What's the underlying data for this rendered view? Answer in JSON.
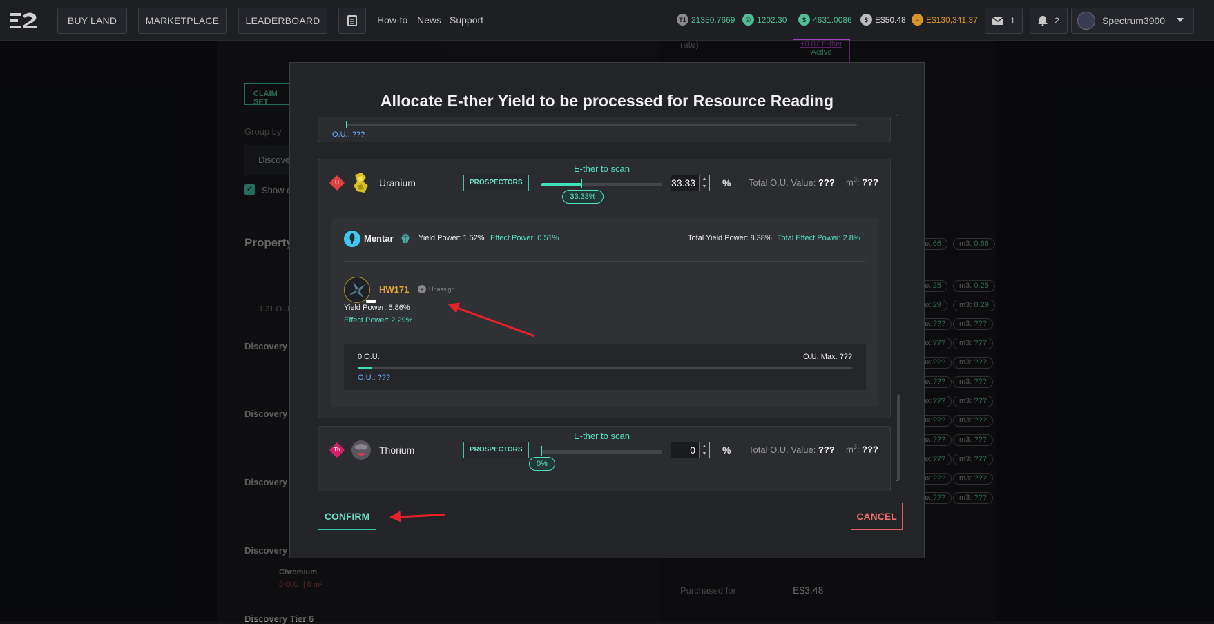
{
  "nav": {
    "buy_land": "BUY LAND",
    "marketplace": "MARKETPLACE",
    "leaderboard": "LEADERBOARD",
    "howto": "How-to",
    "news": "News",
    "support": "Support",
    "stats": [
      {
        "value": "21350.7669",
        "color": "#4fbf93",
        "icon": "t1"
      },
      {
        "value": "1202.30",
        "color": "#4fbf93",
        "icon": "g"
      },
      {
        "value": "4631.0086",
        "color": "#4fbf93",
        "icon": "s"
      },
      {
        "value": "E$50.48",
        "color": "#d8d8d8",
        "icon": "$"
      },
      {
        "value": "E$130,341.37",
        "color": "#d9952a",
        "icon": "b"
      }
    ],
    "messages_count": "1",
    "notifications_count": "2",
    "username": "Spectrum3900"
  },
  "background": {
    "claim": "CLAIM SET",
    "group_by": "Group by",
    "discover": "Discove",
    "show": "Show e",
    "property": "Property",
    "ou_value": "1.31 O.U.",
    "tiers": [
      "Discovery T",
      "Discovery T",
      "Discovery T",
      "Discovery T"
    ],
    "tier6": "Discovery Tier 6",
    "chromium": "Chromium",
    "chromium_sub": "0 O.U. | 0 m³",
    "rate": "rate)",
    "active_link": "+0.07 E-ther",
    "active": "Active",
    "purchased_for": "Purchased for",
    "purchased_value": "E$3.48",
    "pills_max": [
      "66",
      "25",
      "29",
      "???",
      "???",
      "???",
      "???",
      "???",
      "???",
      "???",
      "???",
      "???",
      "???"
    ],
    "pills_m3": [
      "0.66",
      "0.25",
      "0.29",
      "???",
      "???",
      "???",
      "???",
      "???",
      "???",
      "???",
      "???",
      "???",
      "???"
    ],
    "max_prefix": "ax:",
    "m3_prefix": "m3:"
  },
  "modal": {
    "title": "Allocate E-ther Yield to be processed for Resource Reading",
    "top_ou": "O.U.: ???",
    "uranium": {
      "tag": "U",
      "name": "Uranium",
      "prospectors": "PROSPECTORS",
      "scan_label": "E-ther to scan",
      "percent_input": "33.33",
      "percent_badge": "33.33%",
      "percent_sign": "%",
      "fill_fraction": 0.3333,
      "total_ou_label": "Total O.U. Value:",
      "total_ou_value": "???",
      "m3_label": "m",
      "m3_sup": "3",
      "m3_value": "???"
    },
    "mentar": {
      "name": "Mentar",
      "yield_power": "Yield Power: 1.52%",
      "effect_power": "Effect Power: 0.51%",
      "total_yield": "Total Yield Power: 8.38%",
      "total_effect": "Total Effect Power: 2.8%"
    },
    "prospector": {
      "code": "HW171",
      "unassign": "Unassign",
      "yield_power": "Yield Power: 6.86%",
      "effect_power": "Effect Power: 2.29%",
      "ou_left": "0 O.U.",
      "ou_max": "O.U. Max: ???",
      "ou_current": "O.U.: ???"
    },
    "thorium": {
      "tag": "Th",
      "name": "Thorium",
      "prospectors": "PROSPECTORS",
      "scan_label": "E-ther to scan",
      "percent_input": "0",
      "percent_badge": "0%",
      "percent_sign": "%",
      "total_ou_label": "Total O.U. Value:",
      "total_ou_value": "???",
      "m3_label": "m",
      "m3_sup": "3",
      "m3_value": "???"
    },
    "confirm": "CONFIRM",
    "cancel": "CANCEL"
  },
  "colors": {
    "accent": "#3fe0b8",
    "cancel": "#e06060",
    "gold": "#f0b429"
  }
}
